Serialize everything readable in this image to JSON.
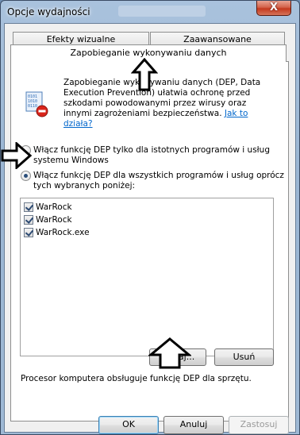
{
  "window": {
    "title": "Opcje wydajności",
    "close_label": "X"
  },
  "tabs": {
    "visual_effects": "Efekty wizualne",
    "advanced": "Zaawansowane",
    "dep": "Zapobieganie wykonywaniu danych"
  },
  "description": {
    "text": "Zapobieganie wykonywaniu danych (DEP, Data Execution Prevention) ułatwia ochronę przed szkodami powodowanymi przez wirusy oraz innymi zagrożeniami bezpieczeństwa.",
    "link": "Jak to działa?"
  },
  "options": {
    "essential_only": "Włącz funkcję DEP tylko dla istotnych programów i usług systemu Windows",
    "all_except": "Włącz funkcję DEP dla wszystkich programów i usług oprócz tych wybranych poniżej:",
    "selected": "all_except"
  },
  "exceptions": [
    {
      "label": "WarRock",
      "checked": true
    },
    {
      "label": "WarRock",
      "checked": true
    },
    {
      "label": "WarRock.exe",
      "checked": true
    }
  ],
  "buttons": {
    "add": "Dodaj...",
    "remove": "Usuń",
    "ok": "OK",
    "cancel": "Anuluj",
    "apply": "Zastosuj"
  },
  "processor_text": "Procesor komputera obsługuje funkcję DEP dla sprzętu.",
  "icons": {
    "dep_icon": "dep-shield-icon",
    "close": "close-icon"
  },
  "colors": {
    "close_button": "#c4391e",
    "link": "#0066cc",
    "frame": "#9bb6d3"
  }
}
